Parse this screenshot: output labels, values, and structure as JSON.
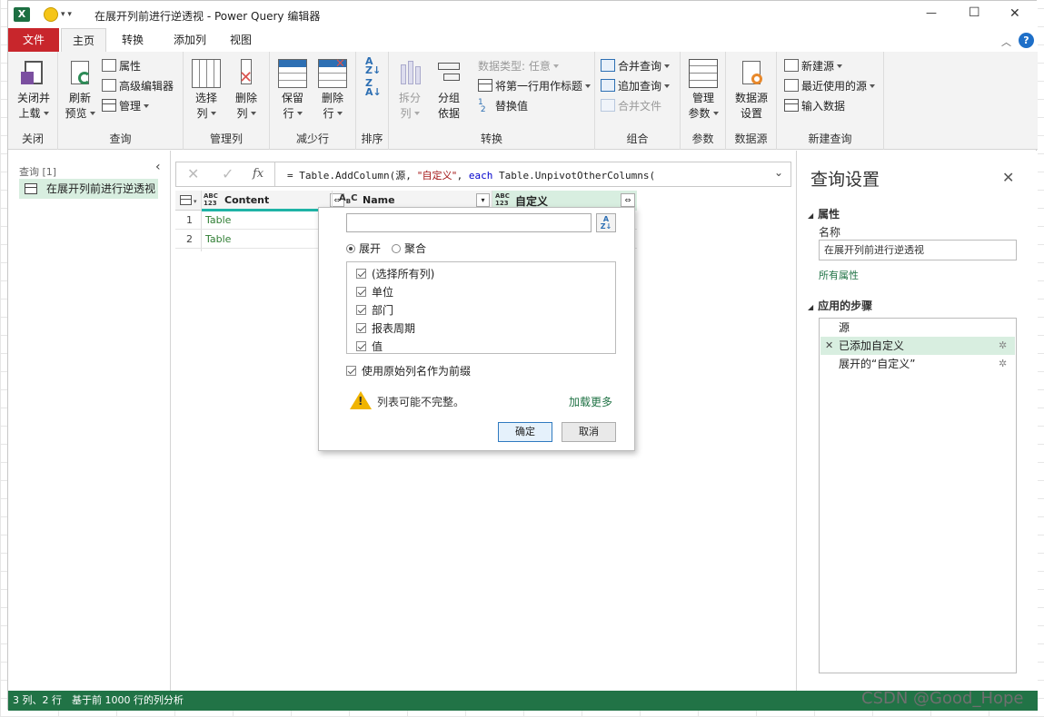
{
  "window": {
    "title": "在展开列前进行逆透视 - Power Query 编辑器",
    "minimize": "—",
    "maximize": "☐",
    "close": "✕"
  },
  "tabs": [
    {
      "label": "文件"
    },
    {
      "label": "主页"
    },
    {
      "label": "转换"
    },
    {
      "label": "添加列"
    },
    {
      "label": "视图"
    }
  ],
  "ribbon": {
    "close_group": {
      "btn": "关闭并\n上载",
      "btn_l1": "关闭并",
      "btn_l2": "上载",
      "label": "关闭"
    },
    "query_group": {
      "refresh_l1": "刷新",
      "refresh_l2": "预览",
      "properties": "属性",
      "advanced": "高级编辑器",
      "manage": "管理",
      "label": "查询"
    },
    "manage_cols": {
      "choose_l1": "选择",
      "choose_l2": "列",
      "remove_l1": "删除",
      "remove_l2": "列",
      "label": "管理列"
    },
    "reduce_rows": {
      "keep_l1": "保留",
      "keep_l2": "行",
      "remove_l1": "删除",
      "remove_l2": "行",
      "label": "减少行"
    },
    "sort": {
      "label": "排序"
    },
    "transform": {
      "split_l1": "拆分",
      "split_l2": "列",
      "group_l1": "分组",
      "group_l2": "依据",
      "datatype": "数据类型: 任意",
      "first_row": "将第一行用作标题",
      "replace": "替换值",
      "label": "转换"
    },
    "combine": {
      "merge": "合并查询",
      "append": "追加查询",
      "combine_files": "合并文件",
      "label": "组合"
    },
    "params": {
      "manage_l1": "管理",
      "manage_l2": "参数",
      "label": "参数"
    },
    "datasource": {
      "settings_l1": "数据源",
      "settings_l2": "设置",
      "label": "数据源"
    },
    "newquery": {
      "new_source": "新建源",
      "recent": "最近使用的源",
      "enter": "输入数据",
      "label": "新建查询"
    }
  },
  "left_pane": {
    "header": "查询 [1]",
    "items": [
      {
        "label": "在展开列前进行逆透视"
      }
    ]
  },
  "formula_bar": {
    "fx": "fx",
    "prefix": "= Table.AddColumn(",
    "src": "源",
    "sep1": ", ",
    "str": "\"自定义\"",
    "sep2": ", ",
    "kw": "each",
    "rest": " Table.UnpivotOtherColumns("
  },
  "grid": {
    "columns": [
      {
        "type": "ABC 123",
        "type1": "ABC",
        "type2": "123",
        "name": "Content"
      },
      {
        "type1": "A",
        "type2": "B",
        "typec": "C",
        "name": "Name"
      },
      {
        "type1": "ABC",
        "type2": "123",
        "name": "自定义"
      }
    ],
    "rows": [
      {
        "num": "1",
        "content": "Table"
      },
      {
        "num": "2",
        "content": "Table"
      }
    ]
  },
  "expand_dialog": {
    "search_value": "",
    "radio_expand": "展开",
    "radio_aggregate": "聚合",
    "columns": [
      {
        "label": "(选择所有列)",
        "checked": true
      },
      {
        "label": "单位",
        "checked": true
      },
      {
        "label": "部门",
        "checked": true
      },
      {
        "label": "报表周期",
        "checked": true
      },
      {
        "label": "值",
        "checked": true
      }
    ],
    "prefix_label": "使用原始列名作为前缀",
    "warning": "列表可能不完整。",
    "load_more": "加载更多",
    "ok": "确定",
    "cancel": "取消"
  },
  "right_pane": {
    "title": "查询设置",
    "properties": "属性",
    "name_label": "名称",
    "name_value": "在展开列前进行逆透视",
    "all_props": "所有属性",
    "steps_header": "应用的步骤",
    "steps": [
      {
        "label": "源"
      },
      {
        "label": "已添加自定义"
      },
      {
        "label": "展开的“自定义”"
      }
    ]
  },
  "status": {
    "cols_rows": "3 列、2 行",
    "profile": "基于前 1000 行的列分析"
  },
  "watermark": "CSDN @Good_Hope",
  "colors": {
    "file_tab": "#c8262c",
    "status": "#217346",
    "accent_green": "#2e7d32",
    "link": "#217346"
  }
}
